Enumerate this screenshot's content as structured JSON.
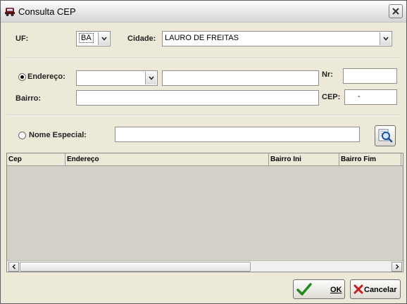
{
  "window": {
    "title": "Consulta CEP",
    "close_icon": "close-icon",
    "app_icon": "car-icon"
  },
  "uf": {
    "label": "UF:",
    "value": "BA"
  },
  "cidade": {
    "label": "Cidade:",
    "value": "LAURO DE FREITAS"
  },
  "endereco": {
    "label": "Endereço:",
    "type_value": "",
    "value": "",
    "selected": true
  },
  "nr": {
    "label": "Nr:",
    "value": ""
  },
  "bairro": {
    "label": "Bairro:",
    "value": ""
  },
  "cep": {
    "label": "CEP:",
    "value": "-"
  },
  "nome_especial": {
    "label": "Nome Especial:",
    "value": "",
    "selected": false
  },
  "search_icon": "search-magnifier-icon",
  "grid": {
    "columns": [
      "Cep",
      "Endereço",
      "Bairro Ini",
      "Bairro Fim",
      "C"
    ],
    "rows": []
  },
  "buttons": {
    "ok": "OK",
    "cancel": "Cancelar"
  },
  "colors": {
    "ok_check": "#1e8a1e",
    "cancel_x": "#c81e1e",
    "background": "#ece9d8"
  }
}
